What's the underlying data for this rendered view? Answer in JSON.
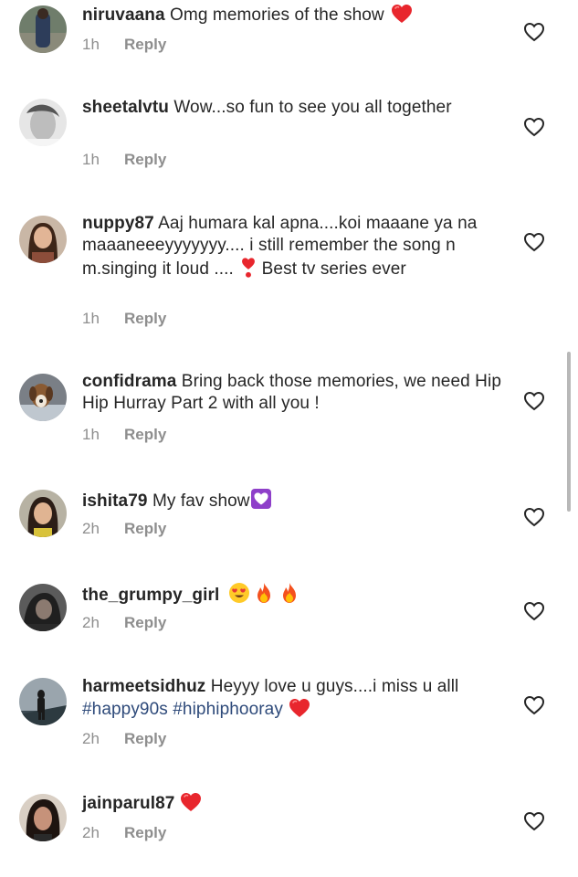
{
  "comments": [
    {
      "username": "niruvaana",
      "text": " Omg memories of the show ",
      "time": "1h",
      "reply": "Reply",
      "avatar": "person-standing-photo",
      "emoji": "red-heart"
    },
    {
      "username": "sheetalvtu",
      "text": " Wow...so fun to see you all together",
      "time": "1h",
      "reply": "Reply",
      "avatar": "face-photo-bw"
    },
    {
      "username": "nuppy87",
      "text": " Aaj humara kal apna....koi maaane ya na maaaneeeyyyyyyy.... i still remember the song n m.singing it loud .... ",
      "text_after": " Best tv series ever",
      "time": "1h",
      "reply": "Reply",
      "avatar": "woman-photo",
      "emoji": "heart-exclamation"
    },
    {
      "username": "confidrama",
      "text": " Bring back those memories, we need Hip Hip Hurray Part 2 with all you !",
      "time": "1h",
      "reply": "Reply",
      "avatar": "dog-photo"
    },
    {
      "username": "ishita79",
      "text": " My fav show",
      "time": "2h",
      "reply": "Reply",
      "avatar": "woman-photo",
      "emoji": "heart-purple-box"
    },
    {
      "username": "the_grumpy_girl",
      "text": " ",
      "time": "2h",
      "reply": "Reply",
      "avatar": "dark-portrait-photo",
      "emojis": [
        "heart-eyes",
        "fire",
        "fire"
      ]
    },
    {
      "username": "harmeetsidhuz",
      "text": " Heyyy love u guys....i miss u alll ",
      "hashtags": [
        "#happy90s",
        "#hiphiphooray"
      ],
      "time": "2h",
      "reply": "Reply",
      "avatar": "man-walking-photo",
      "emoji": "red-heart"
    },
    {
      "username": "jainparul87",
      "text": " ",
      "time": "2h",
      "reply": "Reply",
      "avatar": "woman-dark-hair-photo",
      "emoji": "red-heart"
    }
  ],
  "colors": {
    "text": "#262626",
    "meta": "#8e8e8e",
    "hashtag": "#2e4a7a",
    "heart": "#ed1c24"
  }
}
